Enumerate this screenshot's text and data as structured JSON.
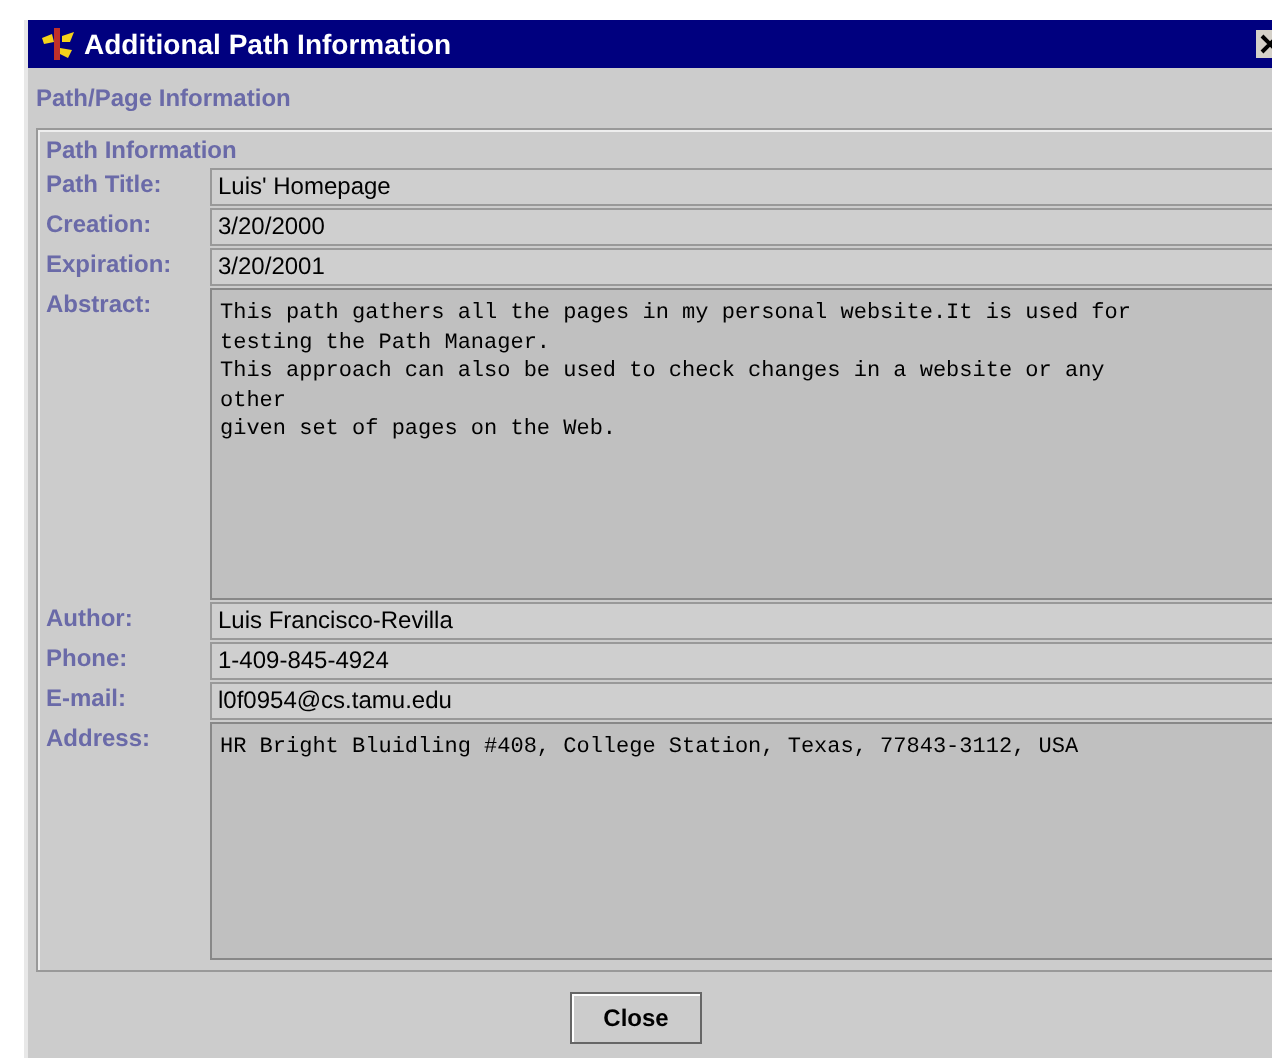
{
  "window": {
    "title": "Additional Path Information"
  },
  "outer_group": {
    "title": "Path/Page Information"
  },
  "group": {
    "title": "Path Information"
  },
  "fields": [
    {
      "kind": "line",
      "label": "Path Title:",
      "value": "Luis' Homepage"
    },
    {
      "kind": "line",
      "label": "Creation:",
      "value": "3/20/2000"
    },
    {
      "kind": "line",
      "label": "Expiration:",
      "value": "3/20/2001"
    },
    {
      "kind": "area",
      "label": "Abstract:",
      "value": "This path gathers all the pages in my personal website.It is used for\ntesting the Path Manager.\nThis approach can also be used to check changes in a website or any\nother\ngiven set of pages on the Web."
    },
    {
      "kind": "line",
      "label": "Author:",
      "value": "Luis Francisco-Revilla"
    },
    {
      "kind": "line",
      "label": "Phone:",
      "value": "1-409-845-4924"
    },
    {
      "kind": "line",
      "label": "E-mail:",
      "value": "l0f0954@cs.tamu.edu"
    },
    {
      "kind": "area",
      "label": "Address:",
      "value": "HR Bright Bluidling #408, College Station, Texas, 77843-3112, USA"
    }
  ],
  "buttons": [
    "Close"
  ]
}
